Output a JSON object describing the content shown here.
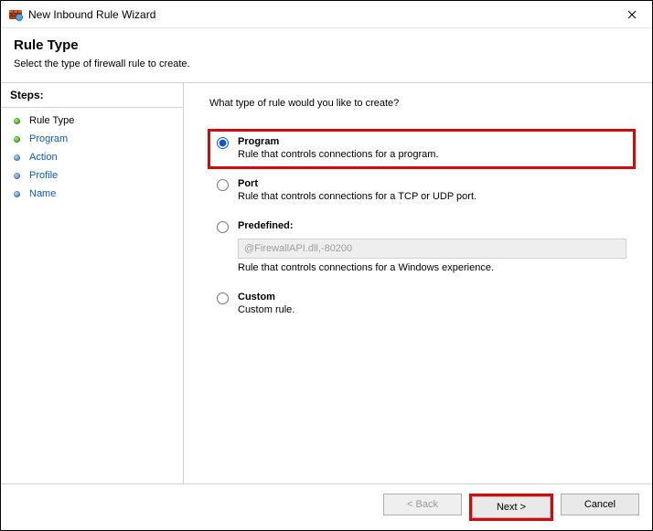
{
  "window": {
    "title": "New Inbound Rule Wizard"
  },
  "header": {
    "title": "Rule Type",
    "subtitle": "Select the type of firewall rule to create."
  },
  "steps": {
    "header": "Steps:",
    "items": [
      {
        "label": "Rule Type",
        "state": "current"
      },
      {
        "label": "Program",
        "state": "next"
      },
      {
        "label": "Action",
        "state": "pending"
      },
      {
        "label": "Profile",
        "state": "pending"
      },
      {
        "label": "Name",
        "state": "pending"
      }
    ]
  },
  "main": {
    "prompt": "What type of rule would you like to create?",
    "options": [
      {
        "key": "program",
        "title": "Program",
        "desc": "Rule that controls connections for a program.",
        "selected": true,
        "highlight": true
      },
      {
        "key": "port",
        "title": "Port",
        "desc": "Rule that controls connections for a TCP or UDP port.",
        "selected": false
      },
      {
        "key": "predefined",
        "title": "Predefined:",
        "desc": "Rule that controls connections for a Windows experience.",
        "selected": false,
        "select_value": "@FirewallAPI.dll,-80200",
        "select_disabled": true
      },
      {
        "key": "custom",
        "title": "Custom",
        "desc": "Custom rule.",
        "selected": false
      }
    ]
  },
  "footer": {
    "back": "< Back",
    "next": "Next >",
    "cancel": "Cancel",
    "back_disabled": true,
    "next_highlight": true
  }
}
